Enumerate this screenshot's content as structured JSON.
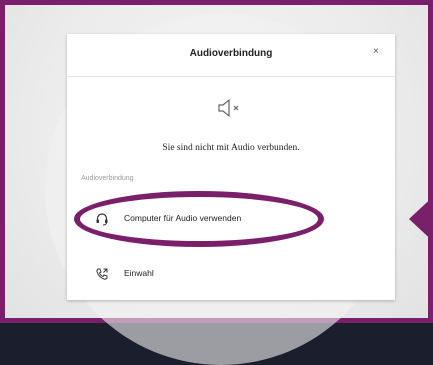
{
  "dialog": {
    "title": "Audioverbindung",
    "close_symbol": "×",
    "status_text": "Sie sind nicht mit Audio verbunden.",
    "section_label": "Audioverbindung",
    "options": [
      {
        "label": "Computer für Audio verwenden",
        "icon": "headset-icon"
      },
      {
        "label": "Einwahl",
        "icon": "phone-icon"
      }
    ]
  },
  "highlight": {
    "color": "#7a1f6a"
  }
}
